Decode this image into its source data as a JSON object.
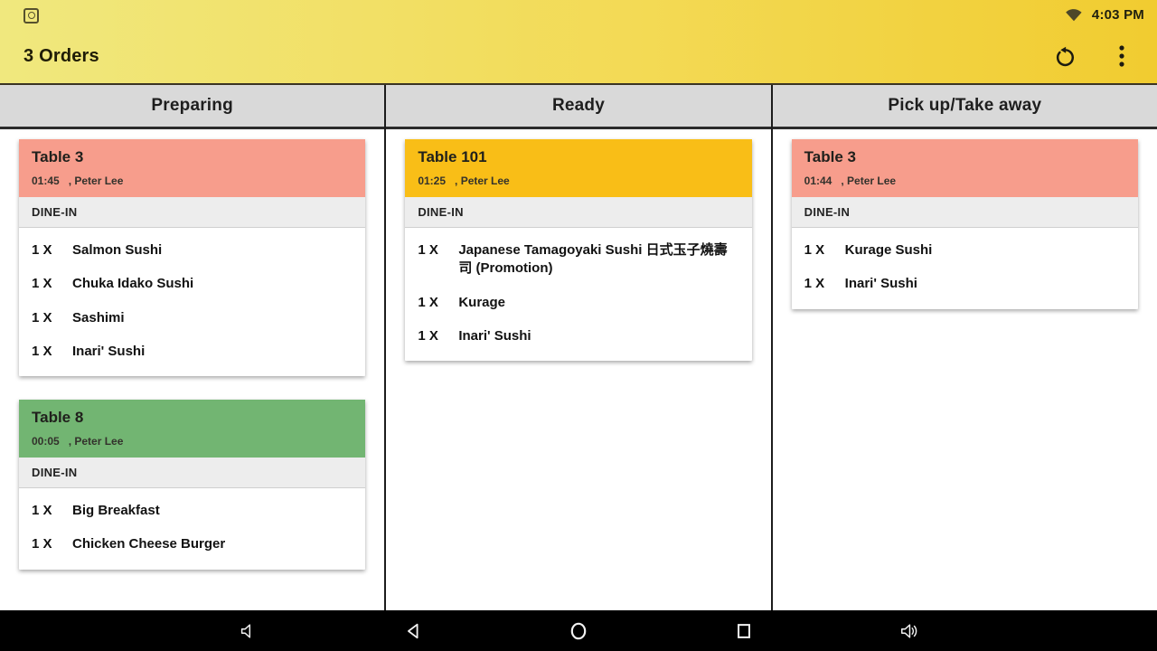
{
  "status_bar": {
    "time": "4:03 PM",
    "icons": [
      "notification-icon",
      "wifi-icon"
    ]
  },
  "app_bar": {
    "title": "3 Orders",
    "actions": [
      "refresh-button",
      "overflow-menu-button"
    ]
  },
  "colors": {
    "topbar_gradient_left": "#f0e87e",
    "topbar_gradient_right": "#f1cc30",
    "column_header_bg": "#d9d9d9",
    "card_header_salmon": "#f79d8c",
    "card_header_green": "#72b572",
    "card_header_amber": "#f9be17",
    "order_type_bg": "#ededed",
    "navbar_bg": "#000000"
  },
  "columns": [
    {
      "label": "Preparing",
      "cards": [
        {
          "table": "Table 3",
          "time": "01:45",
          "customer": ", Peter Lee",
          "order_type": "DINE-IN",
          "header_color": "#f79d8c",
          "items": [
            {
              "qty": "1 X",
              "name": "Salmon Sushi"
            },
            {
              "qty": "1 X",
              "name": "Chuka Idako Sushi"
            },
            {
              "qty": "1 X",
              "name": "Sashimi"
            },
            {
              "qty": "1 X",
              "name": "Inari' Sushi"
            }
          ]
        },
        {
          "table": "Table 8",
          "time": "00:05",
          "customer": ", Peter Lee",
          "order_type": "DINE-IN",
          "header_color": "#72b572",
          "items": [
            {
              "qty": "1 X",
              "name": "Big Breakfast"
            },
            {
              "qty": "1 X",
              "name": "Chicken Cheese Burger"
            }
          ]
        }
      ]
    },
    {
      "label": "Ready",
      "cards": [
        {
          "table": "Table 101",
          "time": "01:25",
          "customer": ", Peter Lee",
          "order_type": "DINE-IN",
          "header_color": "#f9be17",
          "items": [
            {
              "qty": "1 X",
              "name": "Japanese Tamagoyaki Sushi 日式玉子燒壽司 (Promotion)"
            },
            {
              "qty": "1 X",
              "name": "Kurage"
            },
            {
              "qty": "1 X",
              "name": "Inari' Sushi"
            }
          ]
        }
      ]
    },
    {
      "label": "Pick up/Take away",
      "cards": [
        {
          "table": "Table 3",
          "time": "01:44",
          "customer": ", Peter Lee",
          "order_type": "DINE-IN",
          "header_color": "#f79d8c",
          "items": [
            {
              "qty": "1 X",
              "name": "Kurage Sushi"
            },
            {
              "qty": "1 X",
              "name": "Inari' Sushi"
            }
          ]
        }
      ]
    }
  ],
  "navbar": {
    "icons": [
      "volume-down-icon",
      "back-icon",
      "home-icon",
      "recents-icon",
      "volume-up-icon"
    ]
  }
}
